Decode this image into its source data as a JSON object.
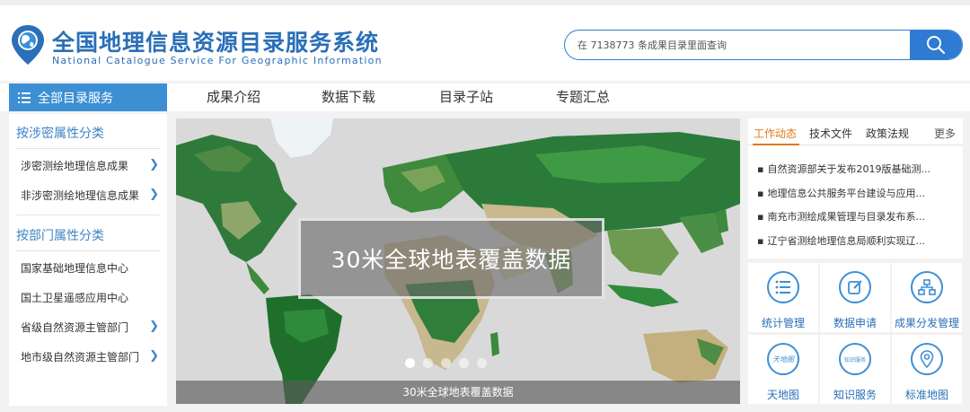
{
  "header": {
    "title": "全国地理信息资源目录服务系统",
    "subtitle": "National Catalogue Service For Geographic Information",
    "search_placeholder": "在 7138773 条成果目录里面查询"
  },
  "nav": {
    "all_label": "全部目录服务",
    "items": [
      "成果介绍",
      "数据下载",
      "目录子站",
      "专题汇总"
    ]
  },
  "sidebar": {
    "section1": "按涉密属性分类",
    "group1": [
      {
        "label": "涉密测绘地理信息成果"
      },
      {
        "label": "非涉密测绘地理信息成果"
      }
    ],
    "section2": "按部门属性分类",
    "group2": [
      {
        "label": "国家基础地理信息中心"
      },
      {
        "label": "国土卫星遥感应用中心"
      },
      {
        "label": "省级自然资源主管部门"
      },
      {
        "label": "地市级自然资源主管部门"
      }
    ]
  },
  "banner": {
    "headline": "30米全球地表覆盖数据",
    "caption": "30米全球地表覆盖数据",
    "slide_count": 5,
    "active_slide": 0
  },
  "news": {
    "tabs": [
      "工作动态",
      "技术文件",
      "政策法规"
    ],
    "active_tab": "工作动态",
    "more": "更多",
    "items": [
      "自然资源部关于发布2019版基础测...",
      "地理信息公共服务平台建设与应用...",
      "南充市测绘成果管理与目录发布系...",
      "辽宁省测绘地理信息局顺利实现辽..."
    ]
  },
  "services": [
    {
      "label": "统计管理",
      "icon": "list-icon"
    },
    {
      "label": "数据申请",
      "icon": "edit-icon"
    },
    {
      "label": "成果分发管理",
      "icon": "hierarchy-icon"
    },
    {
      "label": "天地图",
      "icon": "tianditu-icon",
      "icon_text": "天地图"
    },
    {
      "label": "知识服务",
      "icon": "knowledge-icon",
      "icon_text": "知识服务"
    },
    {
      "label": "标准地图",
      "icon": "map-pin-icon"
    }
  ],
  "colors": {
    "brand": "#2a6fb8",
    "nav_active": "#3d8fd4",
    "tab_active": "#e07a16"
  }
}
